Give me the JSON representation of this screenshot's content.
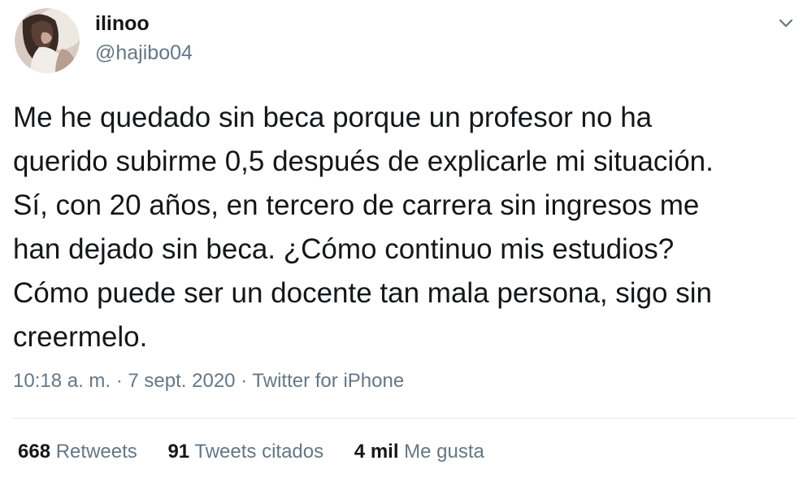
{
  "author": {
    "name": "ilinoo",
    "handle": "@hajibo04",
    "avatar_icon": "profile-photo"
  },
  "menu_icon": "chevron-down-icon",
  "tweet": {
    "text": "Me he quedado sin beca porque un profesor no ha\nquerido subirme 0,5 después de explicarle mi situación.\nSí, con 20 años, en tercero de carrera sin ingresos me\nhan dejado sin beca. ¿Cómo continuo mis estudios?\nCómo puede ser un docente tan mala persona, sigo sin\ncreermelo."
  },
  "meta": {
    "time": "10:18 a. m.",
    "separator": " · ",
    "date": "7 sept. 2020",
    "source": "Twitter for iPhone"
  },
  "stats": [
    {
      "count": "668",
      "label": "Retweets"
    },
    {
      "count": "91",
      "label": "Tweets citados"
    },
    {
      "count": "4 mil",
      "label": "Me gusta"
    }
  ],
  "colors": {
    "text": "#14171a",
    "secondary": "#657786",
    "divider": "#e1e8ed"
  }
}
